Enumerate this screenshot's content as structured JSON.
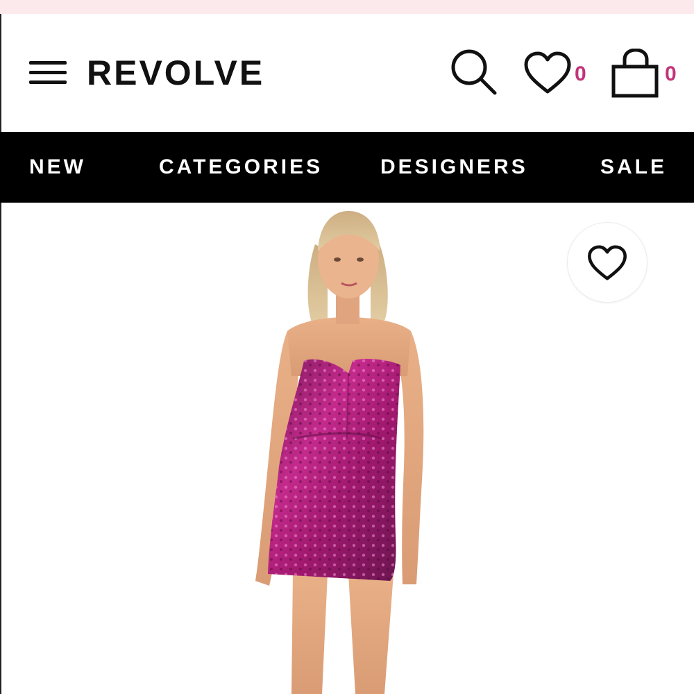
{
  "header": {
    "logo": "REVOLVE",
    "wishlist_count": "0",
    "bag_count": "0",
    "accent": "#c2337a"
  },
  "nav": {
    "items": [
      {
        "label": "NEW"
      },
      {
        "label": "CATEGORIES"
      },
      {
        "label": "DESIGNERS"
      },
      {
        "label": "SALE"
      }
    ]
  },
  "product": {
    "image_icon": "product-photo",
    "dress_color": "#a0186e",
    "favorite_icon": "heart-icon"
  }
}
